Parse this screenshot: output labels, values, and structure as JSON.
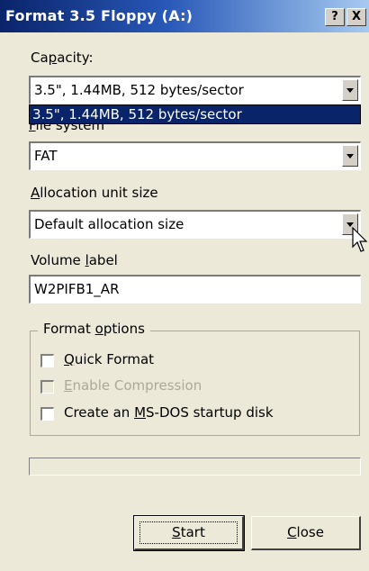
{
  "window": {
    "title": "Format 3.5 Floppy (A:)",
    "help_button": "?",
    "close_button": "X"
  },
  "capacity": {
    "label_pre": "Ca",
    "label_key": "p",
    "label_post": "acity:",
    "value": "3.5\",  1.44MB, 512 bytes/sector",
    "dropdown_option": "3.5\",  1.44MB, 512 bytes/sector"
  },
  "file_system": {
    "label_visible": "ile system",
    "value": "FAT"
  },
  "allocation": {
    "label_key": "A",
    "label_post": "llocation unit size",
    "value": "Default allocation size"
  },
  "volume": {
    "label_pre": "Volume ",
    "label_key": "l",
    "label_post": "abel",
    "value": "W2PIFB1_AR"
  },
  "format_options": {
    "legend_pre": "Format ",
    "legend_key": "o",
    "legend_post": "ptions",
    "quick_format": {
      "key": "Q",
      "rest": "uick Format",
      "checked": false
    },
    "enable_compression": {
      "key": "E",
      "rest": "nable Compression",
      "enabled": false
    },
    "ms_dos": {
      "pre": "Create an ",
      "key": "M",
      "rest": "S-DOS startup disk",
      "checked": false
    }
  },
  "progress": {
    "value": 0
  },
  "buttons": {
    "start_key": "S",
    "start_rest": "tart",
    "close_key": "C",
    "close_rest": "lose"
  }
}
